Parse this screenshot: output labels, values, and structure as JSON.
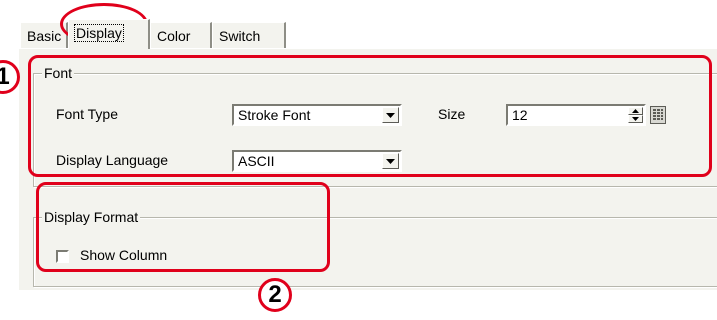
{
  "tabs": [
    {
      "label": "Basic"
    },
    {
      "label": "Display"
    },
    {
      "label": "Color"
    },
    {
      "label": "Switch"
    }
  ],
  "font_group": {
    "title": "Font",
    "font_type_label": "Font Type",
    "font_type_value": "Stroke Font",
    "size_label": "Size",
    "size_value": "12",
    "display_language_label": "Display Language",
    "display_language_value": "ASCII"
  },
  "display_format_group": {
    "title": "Display Format",
    "show_column_label": "Show Column",
    "show_column_checked": false
  },
  "annotations": {
    "marker_1": "1",
    "marker_2": "2",
    "color": "#e0001b"
  }
}
